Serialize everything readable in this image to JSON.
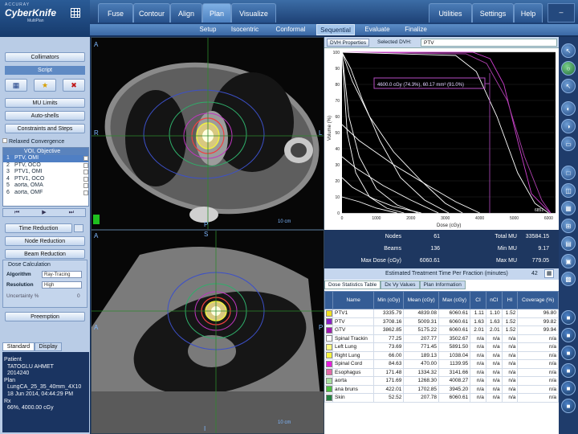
{
  "app": {
    "brand_small": "ACCURAY",
    "brand": "CyberKnife",
    "brand_sub": "MultiPlan"
  },
  "main_tabs": [
    {
      "label": "Fuse"
    },
    {
      "label": "Contour"
    },
    {
      "label": "Align"
    },
    {
      "label": "Plan"
    },
    {
      "label": "Visualize"
    }
  ],
  "right_tabs": [
    {
      "label": "Utilities"
    },
    {
      "label": "Settings"
    },
    {
      "label": "Help"
    }
  ],
  "sub_tabs": [
    {
      "label": "Setup"
    },
    {
      "label": "Isocentric"
    },
    {
      "label": "Conformal"
    },
    {
      "label": "Sequential"
    },
    {
      "label": "Evaluate"
    },
    {
      "label": "Finalize"
    }
  ],
  "left": {
    "collimators": "Collimators",
    "script": "Script",
    "mu_limits": "MU Limits",
    "auto_shells": "Auto-shells",
    "constraints": "Constraints and Steps",
    "relaxed": "Relaxed Convergence",
    "voi_header": "VOI, Objective",
    "voi_rows": [
      {
        "num": "1",
        "name": "PTV, OMI"
      },
      {
        "num": "2",
        "name": "PTV, OCO"
      },
      {
        "num": "3",
        "name": "PTV1, OMI"
      },
      {
        "num": "4",
        "name": "PTV1, OCO"
      },
      {
        "num": "5",
        "name": "aorta, OMA"
      },
      {
        "num": "6",
        "name": "aorta, OMF"
      }
    ],
    "time_reduction": "Time Reduction",
    "node_reduction": "Node Reduction",
    "beam_reduction": "Beam Reduction",
    "dose_calc": "Dose Calculation",
    "algorithm_label": "Algorithm",
    "algorithm_value": "Ray-Tracing",
    "resolution_label": "Resolution",
    "resolution_value": "High",
    "uncertainty_label": "Uncertainty %",
    "uncertainty_value": "0",
    "preemption": "Preemption",
    "tab_standard": "Standard",
    "tab_display": "Display",
    "patient_label": "Patient",
    "patient_name": "TATOGLU AHMET",
    "patient_id": "2014240",
    "plan_label": "Plan",
    "plan_name": "LungCA_25_35_40mm_4X10",
    "plan_date": "18 Jun 2014, 04:44:29 PM",
    "rx_label": "Rx",
    "rx_value": "66%, 4000.00 cGy"
  },
  "viewer": {
    "axial": {
      "a": "A",
      "p": "P",
      "r": "R",
      "l": "L",
      "scale": "10 cm"
    },
    "sagittal": {
      "s": "S",
      "a": "A",
      "p": "P",
      "i": "I",
      "scale": "10 cm"
    }
  },
  "dvh": {
    "properties_btn": "DVH Properties",
    "selected_label": "Selected DVH:",
    "selected_value": "PTV",
    "tooltip": "4600.0 cGy (74.3%), 60.17 mm³ (91.0%)",
    "ylabel": "Volume (%)",
    "xlabel": "Dose (cGy)",
    "xticks": [
      "0",
      "1000",
      "2000",
      "3000",
      "4000",
      "5000",
      "6000"
    ],
    "yticks": [
      "100",
      "90",
      "80",
      "70",
      "60",
      "50",
      "40",
      "30",
      "20",
      "10",
      "0"
    ],
    "corner": "6851"
  },
  "chart_data": {
    "type": "line",
    "xlabel": "Dose (cGy)",
    "ylabel": "Volume (%)",
    "xlim": [
      0,
      6200
    ],
    "ylim": [
      0,
      100
    ],
    "series": [
      {
        "color": "#d040d0",
        "x": [
          0,
          3800,
          4300,
          4700,
          5100,
          5500,
          6050
        ],
        "y": [
          100,
          100,
          96,
          80,
          45,
          12,
          0
        ]
      },
      {
        "color": "#b040b0",
        "x": [
          0,
          3600,
          4200,
          4800,
          5300,
          5800,
          6060
        ],
        "y": [
          100,
          99,
          93,
          70,
          35,
          8,
          0
        ]
      },
      {
        "color": "#ffffff",
        "x": [
          0,
          3300,
          3900,
          4500,
          5100,
          5600,
          6000
        ],
        "y": [
          100,
          98,
          88,
          60,
          25,
          6,
          0
        ]
      },
      {
        "color": "#ffffff",
        "x": [
          0,
          250,
          600,
          1100,
          1700,
          2400,
          3100
        ],
        "y": [
          100,
          90,
          70,
          45,
          22,
          8,
          0
        ]
      },
      {
        "color": "#ffffff",
        "x": [
          0,
          300,
          800,
          1500,
          2300,
          3000,
          3500
        ],
        "y": [
          100,
          82,
          60,
          38,
          20,
          6,
          0
        ]
      },
      {
        "color": "#ffffff",
        "x": [
          0,
          200,
          500,
          1000,
          1600,
          2200
        ],
        "y": [
          100,
          60,
          35,
          15,
          5,
          0
        ]
      },
      {
        "color": "#ffffff",
        "x": [
          0,
          150,
          400,
          800,
          1300,
          1800
        ],
        "y": [
          100,
          50,
          25,
          10,
          3,
          0
        ]
      },
      {
        "color": "#ffffff",
        "x": [
          0,
          500,
          1500,
          2500,
          3300,
          4000
        ],
        "y": [
          55,
          45,
          30,
          17,
          7,
          0
        ]
      },
      {
        "color": "#ffffff",
        "x": [
          0,
          400,
          1200,
          2000,
          2800
        ],
        "y": [
          35,
          28,
          17,
          8,
          0
        ]
      },
      {
        "color": "#ffffff",
        "x": [
          0,
          300,
          900,
          1500,
          2300
        ],
        "y": [
          22,
          16,
          9,
          4,
          0
        ]
      },
      {
        "color": "#ffffff",
        "x": [
          0,
          500,
          1000,
          1600
        ],
        "y": [
          10,
          7,
          3,
          0
        ]
      }
    ]
  },
  "stats": {
    "nodes_label": "Nodes",
    "nodes": "61",
    "beams_label": "Beams",
    "beams": "136",
    "maxdose_label": "Max Dose (cGy)",
    "maxdose": "6060.61",
    "totalmu_label": "Total MU",
    "totalmu": "33584.15",
    "minmu_label": "Min MU",
    "minmu": "9.17",
    "maxmu_label": "Max MU",
    "maxmu": "779.05",
    "est_label": "Estimated Treatment Time Per Fraction (minutes)",
    "est_value": "42"
  },
  "table_tabs": [
    {
      "label": "Dose Statistics Table"
    },
    {
      "label": "Dx Vy Values"
    },
    {
      "label": "Plan Information"
    }
  ],
  "table": {
    "headers": [
      "Name",
      "Min (cGy)",
      "Mean (cGy)",
      "Max (cGy)",
      "CI",
      "nCI",
      "HI",
      "Coverage (%)"
    ],
    "rows": [
      {
        "color": "#f0e020",
        "name": "PTV1",
        "min": "3335.79",
        "mean": "4839.08",
        "max": "6060.61",
        "ci": "1.11",
        "nci": "1.10",
        "hi": "1.52",
        "cov": "96.80"
      },
      {
        "color": "#8a1ec8",
        "name": "PTV",
        "min": "3708.16",
        "mean": "5009.31",
        "max": "6060.61",
        "ci": "1.63",
        "nci": "1.63",
        "hi": "1.52",
        "cov": "99.82"
      },
      {
        "color": "#a01ab0",
        "name": "GTV",
        "min": "3862.85",
        "mean": "5175.22",
        "max": "6060.61",
        "ci": "2.01",
        "nci": "2.01",
        "hi": "1.52",
        "cov": "99.94"
      },
      {
        "color": "#ffffff",
        "name": "Spinal Trackin",
        "min": "77.25",
        "mean": "207.77",
        "max": "3502.67",
        "ci": "n/a",
        "nci": "n/a",
        "hi": "n/a",
        "cov": "n/a"
      },
      {
        "color": "#ffff80",
        "name": "Left Lung",
        "min": "73.69",
        "mean": "771.45",
        "max": "5891.50",
        "ci": "n/a",
        "nci": "n/a",
        "hi": "n/a",
        "cov": "n/a"
      },
      {
        "color": "#f6f640",
        "name": "Right Lung",
        "min": "66.00",
        "mean": "189.13",
        "max": "1038.04",
        "ci": "n/a",
        "nci": "n/a",
        "hi": "n/a",
        "cov": "n/a"
      },
      {
        "color": "#e81ce0",
        "name": "Spinal Cord",
        "min": "84.63",
        "mean": "470.00",
        "max": "1139.95",
        "ci": "n/a",
        "nci": "n/a",
        "hi": "n/a",
        "cov": "n/a"
      },
      {
        "color": "#e46aa8",
        "name": "Esophagus",
        "min": "171.48",
        "mean": "1334.32",
        "max": "3141.66",
        "ci": "n/a",
        "nci": "n/a",
        "hi": "n/a",
        "cov": "n/a"
      },
      {
        "color": "#a8e0a0",
        "name": "aorta",
        "min": "171.69",
        "mean": "1268.30",
        "max": "4008.27",
        "ci": "n/a",
        "nci": "n/a",
        "hi": "n/a",
        "cov": "n/a"
      },
      {
        "color": "#4ac040",
        "name": "ana bruns",
        "min": "422.01",
        "mean": "1702.85",
        "max": "3945.20",
        "ci": "n/a",
        "nci": "n/a",
        "hi": "n/a",
        "cov": "n/a"
      },
      {
        "color": "#208040",
        "name": "Skin",
        "min": "52.52",
        "mean": "207.78",
        "max": "6060.61",
        "ci": "n/a",
        "nci": "n/a",
        "hi": "n/a",
        "cov": "n/a"
      }
    ]
  }
}
